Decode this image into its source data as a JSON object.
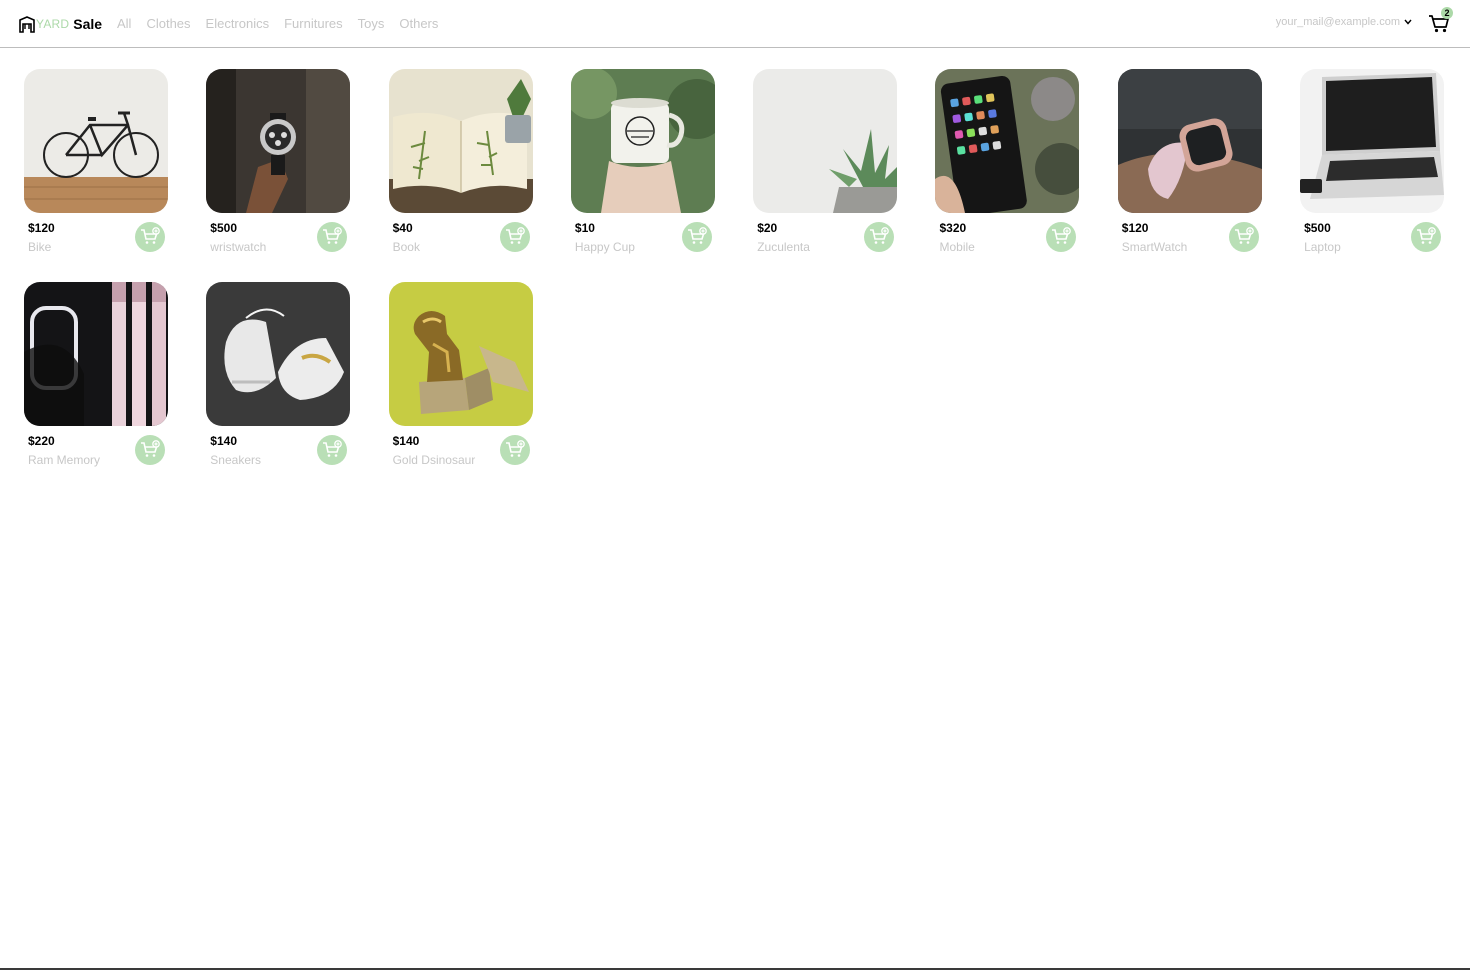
{
  "brand": {
    "yard": "YARD",
    "sale": "Sale",
    "icon": "storefront-icon",
    "accent_color": "#acd9a8"
  },
  "nav": {
    "categories": [
      "All",
      "Clothes",
      "Electronics",
      "Furnitures",
      "Toys",
      "Others"
    ]
  },
  "account": {
    "email": "your_mail@example.com",
    "icon": "chevron-down-icon"
  },
  "cart": {
    "count": "2",
    "icon": "shopping-cart-icon"
  },
  "products": [
    {
      "price": "$120",
      "name": "Bike",
      "image": "bike"
    },
    {
      "price": "$500",
      "name": "wristwatch",
      "image": "wristwatch"
    },
    {
      "price": "$40",
      "name": "Book",
      "image": "book"
    },
    {
      "price": "$10",
      "name": "Happy Cup",
      "image": "cup"
    },
    {
      "price": "$20",
      "name": "Zuculenta",
      "image": "succulent"
    },
    {
      "price": "$320",
      "name": "Mobile",
      "image": "mobile"
    },
    {
      "price": "$120",
      "name": "SmartWatch",
      "image": "smartwatch"
    },
    {
      "price": "$500",
      "name": "Laptop",
      "image": "laptop"
    },
    {
      "price": "$220",
      "name": "Ram Memory",
      "image": "ram"
    },
    {
      "price": "$140",
      "name": "Sneakers",
      "image": "sneakers"
    },
    {
      "price": "$140",
      "name": "Gold Dsinosaur",
      "image": "dinosaur"
    }
  ],
  "add_to_cart_icon": "add-to-cart-icon"
}
